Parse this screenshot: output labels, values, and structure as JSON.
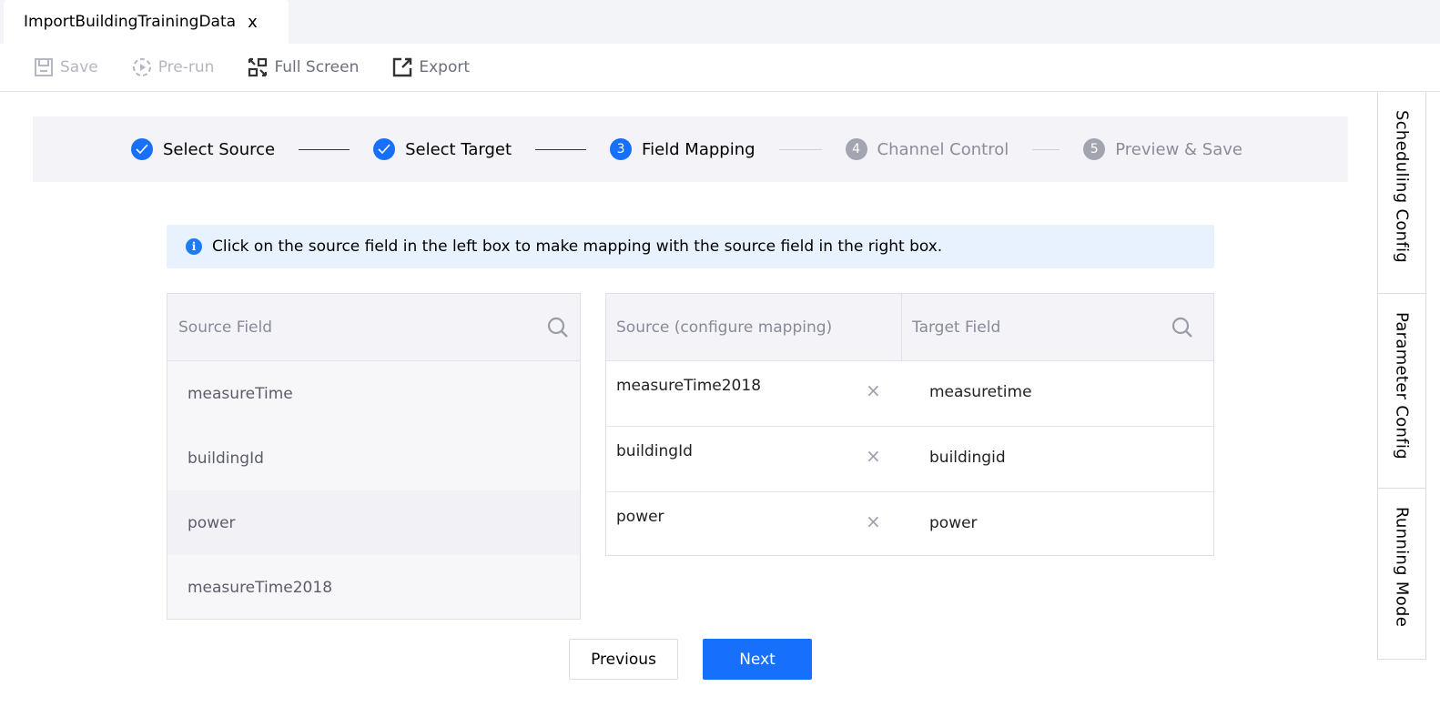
{
  "tabbar": {
    "tab_title": "ImportBuildingTrainingData",
    "close_glyph": "x"
  },
  "toolbar": {
    "items": [
      {
        "label": "Save",
        "icon": "save-icon",
        "state": "disabled"
      },
      {
        "label": "Pre-run",
        "icon": "play-circle-icon",
        "state": "disabled"
      },
      {
        "label": "Full Screen",
        "icon": "fullscreen-icon",
        "state": "enabled"
      },
      {
        "label": "Export",
        "icon": "export-icon",
        "state": "enabled"
      }
    ]
  },
  "stepper": {
    "steps": [
      {
        "number": "1",
        "label": "Select Source",
        "status": "done"
      },
      {
        "number": "2",
        "label": "Select Target",
        "status": "done"
      },
      {
        "number": "3",
        "label": "Field Mapping",
        "status": "active"
      },
      {
        "number": "4",
        "label": "Channel Control",
        "status": "todo"
      },
      {
        "number": "5",
        "label": "Preview & Save",
        "status": "todo"
      }
    ]
  },
  "info": {
    "icon": "info-icon",
    "text": "Click on the source field in the left box to make mapping with the source field in the right box."
  },
  "source_box": {
    "header": "Source Field",
    "items": [
      "measureTime",
      "buildingId",
      "power",
      "measureTime2018"
    ]
  },
  "mapping_box": {
    "header_source": "Source (configure mapping)",
    "header_target": "Target Field",
    "rows": [
      {
        "source": "measureTime2018",
        "remove": "×",
        "target": "measuretime"
      },
      {
        "source": "buildingId",
        "remove": "×",
        "target": "buildingid"
      },
      {
        "source": "power",
        "remove": "×",
        "target": "power"
      }
    ]
  },
  "buttons": {
    "previous": "Previous",
    "next": "Next"
  },
  "side_panel": {
    "tabs": [
      "Scheduling Config",
      "Parameter Config",
      "Running Mode"
    ]
  },
  "colors": {
    "primary": "#1670fc",
    "info_bg": "#e8f2fe",
    "stepper_bg": "#f4f4f8",
    "muted": "#a2a4b0"
  }
}
